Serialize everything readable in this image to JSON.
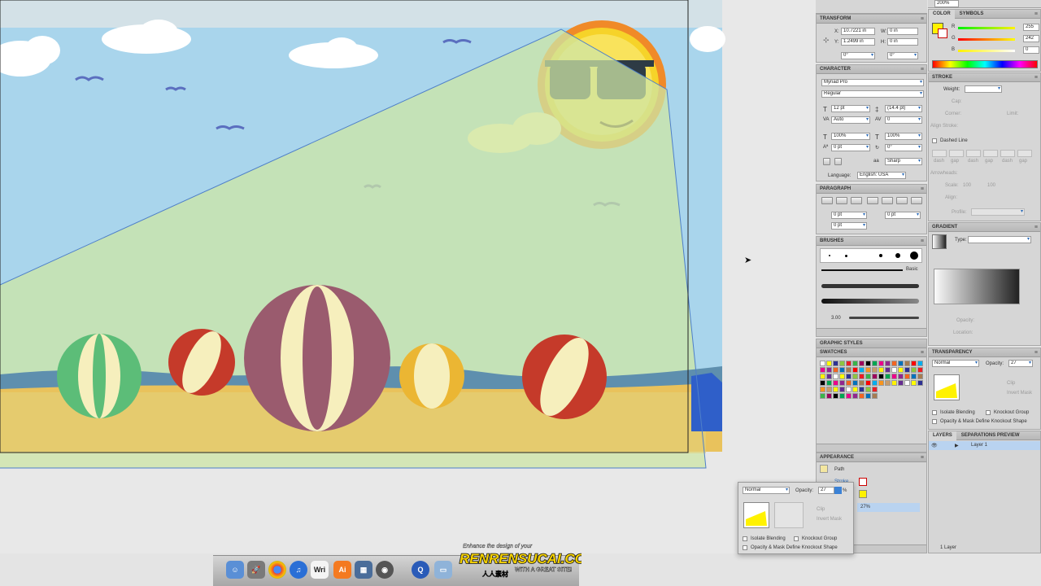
{
  "top": {
    "zoom": "200%"
  },
  "transform": {
    "title": "TRANSFORM",
    "x_label": "X:",
    "x": "10.7221 in",
    "y_label": "Y:",
    "y": "1.2499 in",
    "w_label": "W:",
    "w": "0 in",
    "h_label": "H:",
    "h": "0 in",
    "rot": "0°",
    "shear": "0°"
  },
  "character": {
    "title": "CHARACTER",
    "font": "Myriad Pro",
    "style": "Regular",
    "size": "12 pt",
    "leading": "(14.4 pt)",
    "kerning": "Auto",
    "tracking": "0",
    "hscale": "100%",
    "vscale": "100%",
    "baseline": "0 pt",
    "rotation": "0°",
    "aa": "Sharp",
    "language_label": "Language:",
    "language": "English: USA"
  },
  "paragraph": {
    "title": "PARAGRAPH",
    "left_indent": "0 pt",
    "right_indent": "0 pt",
    "first_indent": "0 pt"
  },
  "brushes": {
    "title": "BRUSHES",
    "basic_label": "Basic",
    "size": "3.00"
  },
  "graphic_styles": {
    "title": "GRAPHIC STYLES"
  },
  "swatches": {
    "title": "SWATCHES"
  },
  "appearance": {
    "title": "APPEARANCE",
    "object": "Path",
    "stroke_label": "Stroke",
    "fill_label": "Fill",
    "opacity_value": "27%"
  },
  "color": {
    "tab1": "COLOR",
    "tab2": "SYMBOLS",
    "r_label": "R",
    "r": "255",
    "g_label": "G",
    "g": "242",
    "b_label": "B",
    "b": "0",
    "accent": "#fff200"
  },
  "stroke": {
    "title": "STROKE",
    "weight_label": "Weight:",
    "cap_label": "Cap:",
    "corner_label": "Corner:",
    "limit_label": "Limit:",
    "align_label": "Align Stroke:",
    "dashed_label": "Dashed Line",
    "dash_labels": [
      "dash",
      "gap",
      "dash",
      "gap",
      "dash",
      "gap"
    ],
    "arrowheads_label": "Arrowheads:",
    "scale_label": "Scale:",
    "scale1": "100",
    "scale2": "100",
    "align2_label": "Align:",
    "profile_label": "Profile:"
  },
  "gradient": {
    "title": "GRADIENT",
    "type_label": "Type:",
    "opacity_label": "Opacity:",
    "location_label": "Location:"
  },
  "transparency": {
    "title": "TRANSPARENCY",
    "mode": "Normal",
    "opacity_label": "Opacity:",
    "opacity": "27",
    "clip_label": "Clip",
    "invert_label": "Invert Mask",
    "isolate_label": "Isolate Blending",
    "knockout_label": "Knockout Group",
    "opacity_mask_label": "Opacity & Mask Define Knockout Shape"
  },
  "layers": {
    "tab1": "LAYERS",
    "tab2": "SEPARATIONS PREVIEW",
    "layer_name": "Layer 1",
    "count": "1 Layer"
  },
  "popup": {
    "mode": "Normal",
    "opacity_label": "Opacity:",
    "opacity": "27",
    "unit": "%",
    "clip_label": "Clip",
    "invert_label": "Invert Mask",
    "isolate_label": "Isolate Blending",
    "knockout_label": "Knockout Group",
    "opacity_mask_label": "Opacity & Mask Define Knockout Shape"
  },
  "dock": {
    "items": [
      "Finder",
      "Launchpad",
      "Chrome",
      "iTunes",
      "Wri",
      "Ai",
      "Preview",
      "Photo Booth",
      "Q",
      "Folder"
    ],
    "wri_label": "Wri",
    "ai_label": "Ai"
  },
  "watermark": {
    "line1": "Enhance the design of your",
    "brand": "RENRENSUCAI.COM",
    "line3": "WITH A GREAT SITE!",
    "cn": "人人素材"
  },
  "colors": {
    "sky": "#a9d5ec",
    "sand": "#e9c25c",
    "overlay": "#cde6a6",
    "selection": "#4e7fc9",
    "ui_bg": "#d6d6d6"
  }
}
